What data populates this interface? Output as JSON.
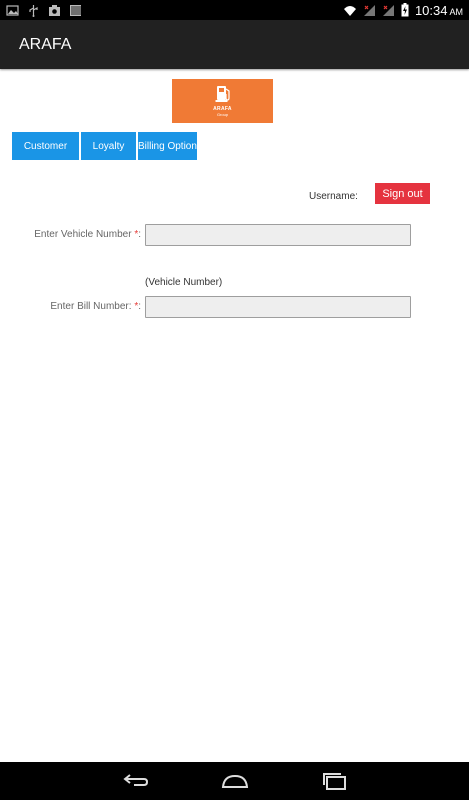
{
  "status_bar": {
    "time": "10:34",
    "ampm": "AM",
    "left_icons": [
      "image-icon",
      "usb-icon",
      "screenshot-icon",
      "barcode-icon"
    ],
    "right_icons": [
      "wifi-icon",
      "signal-icon",
      "signal-icon",
      "battery-charging-icon"
    ]
  },
  "app_bar": {
    "title": "ARAFA"
  },
  "logo": {
    "brand": "ARAFA",
    "sub": "Group",
    "background": "#f07a35"
  },
  "tabs": [
    {
      "label": "Customer"
    },
    {
      "label": "Loyalty"
    },
    {
      "label": "Billing Option"
    }
  ],
  "account": {
    "username_label": "Username:",
    "sign_out_label": "Sign out"
  },
  "form": {
    "vehicle": {
      "label": "Enter Vehicle Number ",
      "required_mark": "*",
      "colon": ":",
      "value": "",
      "hint": "(Vehicle Number)"
    },
    "bill": {
      "label": "Enter Bill Number: ",
      "required_mark": "*",
      "colon": ":",
      "value": ""
    }
  },
  "colors": {
    "tab_blue": "#1a95e6",
    "sign_out_red": "#e5333f",
    "action_bar": "#212121"
  },
  "nav_bar": {
    "buttons": [
      "back-icon",
      "home-icon",
      "recent-apps-icon"
    ]
  }
}
